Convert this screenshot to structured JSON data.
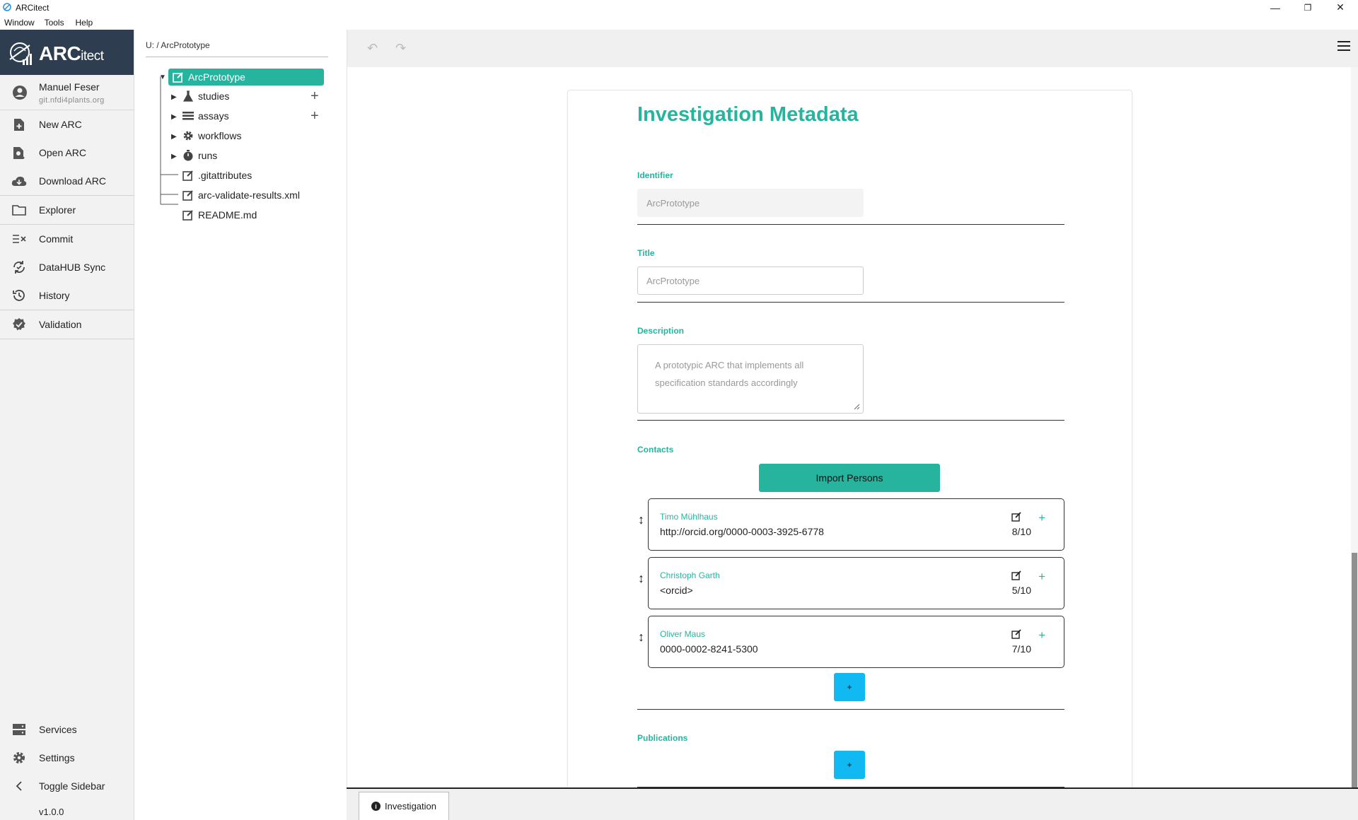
{
  "window": {
    "title": "ARCitect",
    "controls": [
      "—",
      "❐",
      "✕"
    ]
  },
  "menu": [
    "Window",
    "Tools",
    "Help"
  ],
  "brand": {
    "main": "ARC",
    "sub": "itect"
  },
  "user": {
    "name": "Manuel Feser",
    "host": "git.nfdi4plants.org"
  },
  "sidebar": {
    "items": [
      {
        "label": "New ARC",
        "icon": "new-file-icon"
      },
      {
        "label": "Open ARC",
        "icon": "open-file-icon"
      },
      {
        "label": "Download ARC",
        "icon": "cloud-download-icon"
      },
      {
        "label": "Explorer",
        "icon": "folder-icon"
      },
      {
        "label": "Commit",
        "icon": "commit-icon"
      },
      {
        "label": "DataHUB Sync",
        "icon": "sync-icon"
      },
      {
        "label": "History",
        "icon": "history-icon"
      },
      {
        "label": "Validation",
        "icon": "validation-badge-icon"
      }
    ],
    "bottom_items": [
      {
        "label": "Services",
        "icon": "services-icon"
      },
      {
        "label": "Settings",
        "icon": "gear-icon"
      },
      {
        "label": "Toggle Sidebar",
        "icon": "chevron-left-icon"
      }
    ],
    "version": "v1.0.0"
  },
  "tree": {
    "breadcrumb": "U: / ArcPrototype",
    "root": "ArcPrototype",
    "nodes": [
      {
        "label": "studies",
        "icon": "flask-icon"
      },
      {
        "label": "assays",
        "icon": "list-icon"
      },
      {
        "label": "workflows",
        "icon": "gear-icon"
      },
      {
        "label": "runs",
        "icon": "stopwatch-icon"
      },
      {
        "label": ".gitattributes",
        "icon": "edit-file-icon"
      },
      {
        "label": "arc-validate-results.xml",
        "icon": "edit-file-icon"
      },
      {
        "label": "README.md",
        "icon": "edit-file-icon"
      }
    ]
  },
  "form": {
    "title": "Investigation Metadata",
    "identifier": {
      "label": "Identifier",
      "value": "ArcPrototype"
    },
    "title_field": {
      "label": "Title",
      "placeholder": "ArcPrototype"
    },
    "description": {
      "label": "Description",
      "placeholder": "A prototypic ARC that implements all specification standards accordingly"
    },
    "contacts": {
      "label": "Contacts",
      "import_button": "Import Persons",
      "people": [
        {
          "name": "Timo Mühlhaus",
          "orcid": "http://orcid.org/0000-0003-3925-6778",
          "score": "8/10"
        },
        {
          "name": "Christoph Garth",
          "orcid": "<orcid>",
          "score": "5/10"
        },
        {
          "name": "Oliver Maus",
          "orcid": "0000-0002-8241-5300",
          "score": "7/10"
        }
      ],
      "add_label": "+"
    },
    "publications": {
      "label": "Publications",
      "add_label": "+"
    }
  },
  "tabs": [
    {
      "label": "Investigation",
      "icon": "info-icon"
    }
  ],
  "colors": {
    "accent": "#27b49f",
    "add_button": "#10b9f1",
    "sidebar_header": "#2e3e50"
  }
}
